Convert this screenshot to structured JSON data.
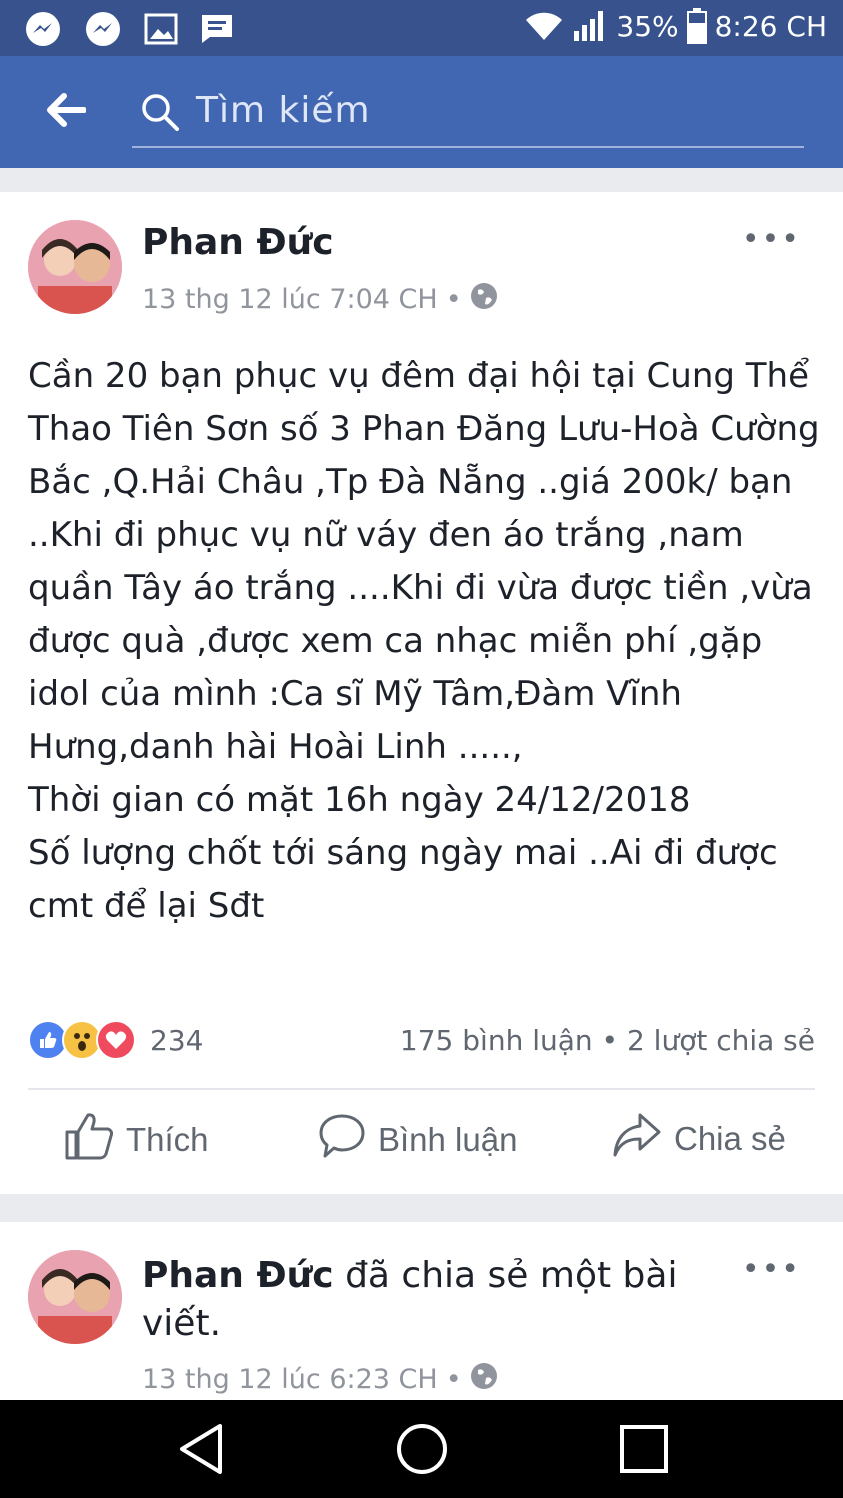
{
  "status_bar": {
    "battery": "35%",
    "time": "8:26 CH",
    "left_icons": [
      "messenger-icon",
      "messenger-icon",
      "image-icon",
      "message-icon"
    ],
    "right_icons": [
      "wifi-icon",
      "signal-icon",
      "battery-icon"
    ]
  },
  "search": {
    "placeholder": "Tìm kiếm"
  },
  "post": {
    "author": "Phan Đức",
    "timestamp": "13 thg 12 lúc 7:04 CH",
    "separator": "•",
    "more": "•••",
    "body_lines": [
      "Cần 20 bạn phục vụ đêm đại hội tại Cung Thể Thao Tiên Sơn số 3 Phan Đăng Lưu-Hoà Cường Bắc ,Q.Hải Châu ,Tp Đà Nẵng ..giá 200k/ bạn ..Khi đi phục vụ nữ váy đen áo trắng ,nam quần Tây áo trắng ....Khi đi vừa được tiền ,vừa được quà ,được xem ca nhạc miễn phí ,gặp idol của mình :Ca sĩ Mỹ Tâm,Đàm Vĩnh Hưng,danh hài Hoài Linh .....,",
      "Thời gian có mặt 16h ngày 24/12/2018",
      "Số lượng chốt tới sáng ngày mai ..Ai đi được cmt để lại Sđt"
    ],
    "reaction_count": "234",
    "comments_shares": "175 bình luận • 2 lượt chia sẻ",
    "actions": {
      "like": "Thích",
      "comment": "Bình luận",
      "share": "Chia sẻ"
    }
  },
  "shared_post": {
    "author": "Phan Đức",
    "action_text": "đã chia sẻ một bài viết.",
    "timestamp": "13 thg 12 lúc 6:23 CH",
    "separator": "•",
    "more": "•••"
  },
  "colors": {
    "status_bar": "#37528c",
    "header": "#4267b2",
    "like_blue": "#4e82f0",
    "love_red": "#f04a5f",
    "wow_yellow": "#f7c244"
  }
}
